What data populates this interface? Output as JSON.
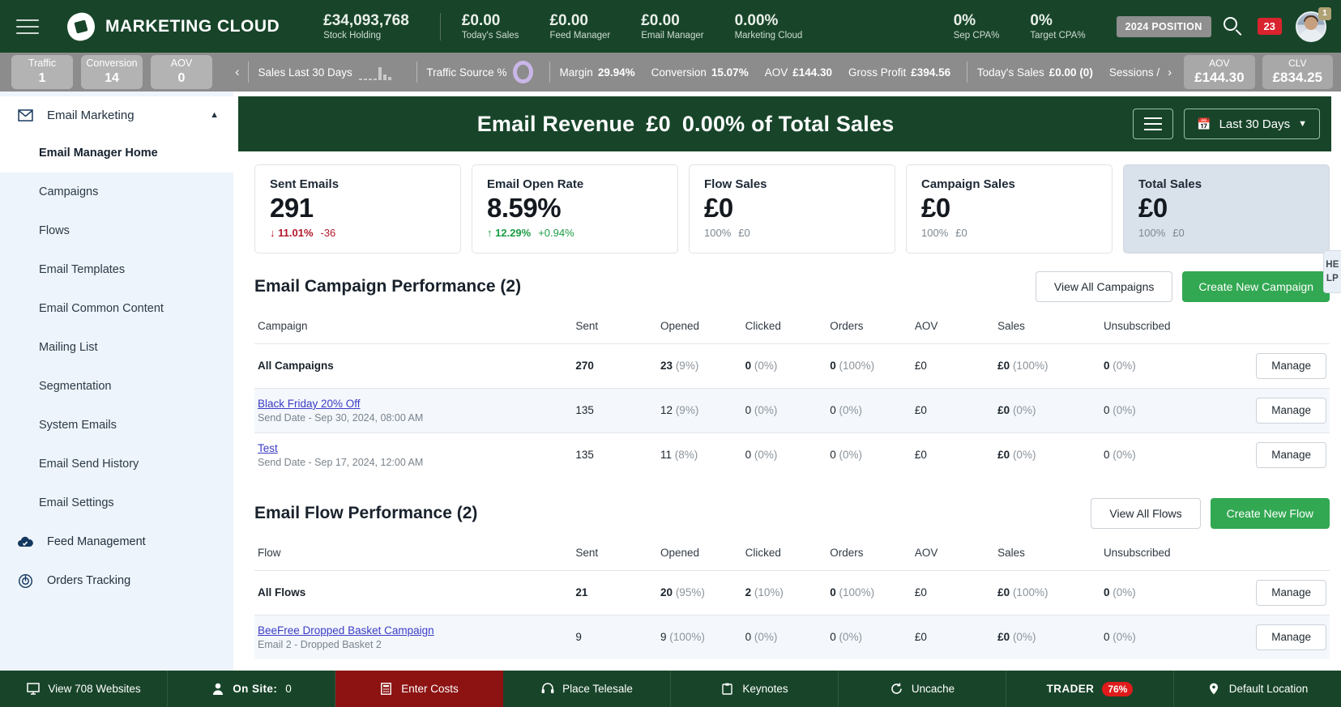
{
  "topbar": {
    "brand": "MARKETING CLOUD",
    "metrics": [
      {
        "value": "£34,093,768",
        "label": "Stock Holding"
      },
      {
        "value": "£0.00",
        "label": "Today's Sales"
      },
      {
        "value": "£0.00",
        "label": "Feed Manager"
      },
      {
        "value": "£0.00",
        "label": "Email Manager"
      },
      {
        "value": "0.00%",
        "label": "Marketing Cloud"
      },
      {
        "value": "0%",
        "label": "Sep CPA%"
      },
      {
        "value": "0%",
        "label": "Target CPA%"
      }
    ],
    "position_badge": "2024 POSITION",
    "notification_count": "23",
    "avatar_badge": "1"
  },
  "metricsbar": {
    "chips": [
      {
        "title": "Traffic",
        "number": "1"
      },
      {
        "title": "Conversion",
        "number": "14"
      },
      {
        "title": "AOV",
        "number": "0"
      }
    ],
    "sales_label": "Sales Last 30 Days",
    "traffic_source_label": "Traffic Source %",
    "stats": [
      {
        "label": "Margin",
        "value": "29.94%"
      },
      {
        "label": "Conversion",
        "value": "15.07%"
      },
      {
        "label": "AOV",
        "value": "£144.30"
      },
      {
        "label": "Gross Profit",
        "value": "£394.56"
      }
    ],
    "todays_sales_label": "Today's Sales",
    "todays_sales_value": "£0.00 (0)",
    "sessions_label": "Sessions /",
    "right_chips": [
      {
        "title": "AOV",
        "number": "£144.30"
      },
      {
        "title": "CLV",
        "number": "£834.25"
      }
    ]
  },
  "sidebar": {
    "group": {
      "label": "Email Marketing",
      "icon": "envelope-icon"
    },
    "items": [
      {
        "label": "Email Manager Home",
        "active": true
      },
      {
        "label": "Campaigns",
        "active": false
      },
      {
        "label": "Flows",
        "active": false
      },
      {
        "label": "Email Templates",
        "active": false
      },
      {
        "label": "Email Common Content",
        "active": false
      },
      {
        "label": "Mailing List",
        "active": false
      },
      {
        "label": "Segmentation",
        "active": false
      },
      {
        "label": "System Emails",
        "active": false
      },
      {
        "label": "Email Send History",
        "active": false
      },
      {
        "label": "Email Settings",
        "active": false
      }
    ],
    "roots": [
      {
        "label": "Feed Management",
        "icon": "cloud-check-icon"
      },
      {
        "label": "Orders Tracking",
        "icon": "target-icon"
      }
    ]
  },
  "banner": {
    "title": "Email Revenue",
    "amount": "£0",
    "percent": "0.00% of Total Sales",
    "date_range": "Last 30 Days"
  },
  "cards": [
    {
      "title": "Sent Emails",
      "value": "291",
      "delta": "11.01%",
      "delta_dir": "down",
      "sub": "-36",
      "sub_dir": "down",
      "highlight": false
    },
    {
      "title": "Email Open Rate",
      "value": "8.59%",
      "delta": "12.29%",
      "delta_dir": "up",
      "sub": "+0.94%",
      "sub_dir": "up",
      "highlight": false
    },
    {
      "title": "Flow Sales",
      "value": "£0",
      "delta": "100%",
      "delta_dir": "none",
      "sub": "£0",
      "sub_dir": "none",
      "highlight": false
    },
    {
      "title": "Campaign Sales",
      "value": "£0",
      "delta": "100%",
      "delta_dir": "none",
      "sub": "£0",
      "sub_dir": "none",
      "highlight": false
    },
    {
      "title": "Total Sales",
      "value": "£0",
      "delta": "100%",
      "delta_dir": "none",
      "sub": "£0",
      "sub_dir": "none",
      "highlight": true
    }
  ],
  "campaign_section": {
    "title": "Email Campaign Performance (2)",
    "view_all": "View All Campaigns",
    "create": "Create New Campaign",
    "headers": [
      "Campaign",
      "Sent",
      "Opened",
      "Clicked",
      "Orders",
      "AOV",
      "Sales",
      "Unsubscribed"
    ],
    "action_label": "Manage",
    "rows": [
      {
        "name": "All Campaigns",
        "is_link": false,
        "sub": "",
        "bold": true,
        "sent": "270",
        "opened": "23",
        "opened_pct": "(9%)",
        "clicked": "0",
        "clicked_pct": "(0%)",
        "orders": "0",
        "orders_pct": "(100%)",
        "aov": "£0",
        "sales": "£0",
        "sales_pct": "(100%)",
        "unsub": "0",
        "unsub_pct": "(0%)",
        "alt": false
      },
      {
        "name": "Black Friday 20% Off",
        "is_link": true,
        "sub": "Send Date - Sep 30, 2024, 08:00 AM",
        "bold": false,
        "sent": "135",
        "opened": "12",
        "opened_pct": "(9%)",
        "clicked": "0",
        "clicked_pct": "(0%)",
        "orders": "0",
        "orders_pct": "(0%)",
        "aov": "£0",
        "sales": "£0",
        "sales_pct": "(0%)",
        "unsub": "0",
        "unsub_pct": "(0%)",
        "alt": true
      },
      {
        "name": "Test",
        "is_link": true,
        "sub": "Send Date - Sep 17, 2024, 12:00 AM",
        "bold": false,
        "sent": "135",
        "opened": "11",
        "opened_pct": "(8%)",
        "clicked": "0",
        "clicked_pct": "(0%)",
        "orders": "0",
        "orders_pct": "(0%)",
        "aov": "£0",
        "sales": "£0",
        "sales_pct": "(0%)",
        "unsub": "0",
        "unsub_pct": "(0%)",
        "alt": false
      }
    ]
  },
  "flow_section": {
    "title": "Email Flow Performance (2)",
    "view_all": "View All Flows",
    "create": "Create New Flow",
    "headers": [
      "Flow",
      "Sent",
      "Opened",
      "Clicked",
      "Orders",
      "AOV",
      "Sales",
      "Unsubscribed"
    ],
    "action_label": "Manage",
    "rows": [
      {
        "name": "All Flows",
        "is_link": false,
        "sub": "",
        "bold": true,
        "sent": "21",
        "opened": "20",
        "opened_pct": "(95%)",
        "clicked": "2",
        "clicked_pct": "(10%)",
        "orders": "0",
        "orders_pct": "(100%)",
        "aov": "£0",
        "sales": "£0",
        "sales_pct": "(100%)",
        "unsub": "0",
        "unsub_pct": "(0%)",
        "alt": false
      },
      {
        "name": "BeeFree Dropped Basket Campaign",
        "is_link": true,
        "sub": "Email 2 - Dropped Basket 2",
        "bold": false,
        "sent": "9",
        "opened": "9",
        "opened_pct": "(100%)",
        "clicked": "0",
        "clicked_pct": "(0%)",
        "orders": "0",
        "orders_pct": "(0%)",
        "aov": "£0",
        "sales": "£0",
        "sales_pct": "(0%)",
        "unsub": "0",
        "unsub_pct": "(0%)",
        "alt": true
      }
    ]
  },
  "help_tab": "HELP",
  "bottombar": [
    {
      "label": "View 708 Websites",
      "icon": "monitor-icon",
      "red": false,
      "badge": ""
    },
    {
      "label": "On Site:",
      "icon": "person-icon",
      "red": false,
      "badge": "",
      "extra": "0"
    },
    {
      "label": "Enter Costs",
      "icon": "calculator-icon",
      "red": true,
      "badge": ""
    },
    {
      "label": "Place Telesale",
      "icon": "headset-icon",
      "red": false,
      "badge": ""
    },
    {
      "label": "Keynotes",
      "icon": "clipboard-icon",
      "red": false,
      "badge": ""
    },
    {
      "label": "Uncache",
      "icon": "refresh-icon",
      "red": false,
      "badge": ""
    },
    {
      "label": "TRADER",
      "icon": "",
      "red": false,
      "badge": "76%"
    },
    {
      "label": "Default Location",
      "icon": "pin-icon",
      "red": false,
      "badge": ""
    }
  ]
}
